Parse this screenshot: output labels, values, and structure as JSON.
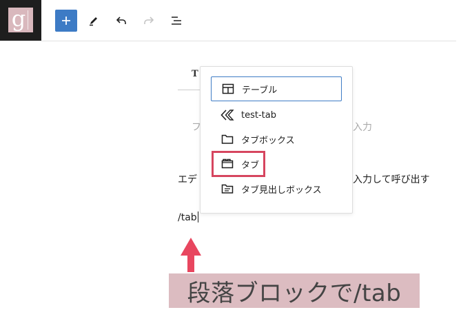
{
  "toolbar": {
    "logo_letter": "g",
    "buttons": [
      "add-block",
      "edit",
      "undo",
      "redo",
      "list-view"
    ]
  },
  "editor": {
    "title_partial": "T",
    "placeholder_left": "フ",
    "placeholder_right": "入力",
    "paragraph_left": "エデ",
    "paragraph_right": "入力して呼び出す",
    "slash_command": "/tab"
  },
  "autocomplete": {
    "items": [
      {
        "label": "テーブル",
        "icon": "table-icon"
      },
      {
        "label": "test-tab",
        "icon": "chevron-double-left-icon"
      },
      {
        "label": "タブボックス",
        "icon": "folder-icon"
      },
      {
        "label": "タブ",
        "icon": "tab-icon"
      },
      {
        "label": "タブ見出しボックス",
        "icon": "folder-text-icon"
      }
    ]
  },
  "caption": {
    "text": "段落ブロックで/tab"
  },
  "colors": {
    "accent": "#3d7bc5",
    "highlight": "#d6455f",
    "caption_bg": "#dcbcc1",
    "logo_bg": "#d9b8bd"
  }
}
